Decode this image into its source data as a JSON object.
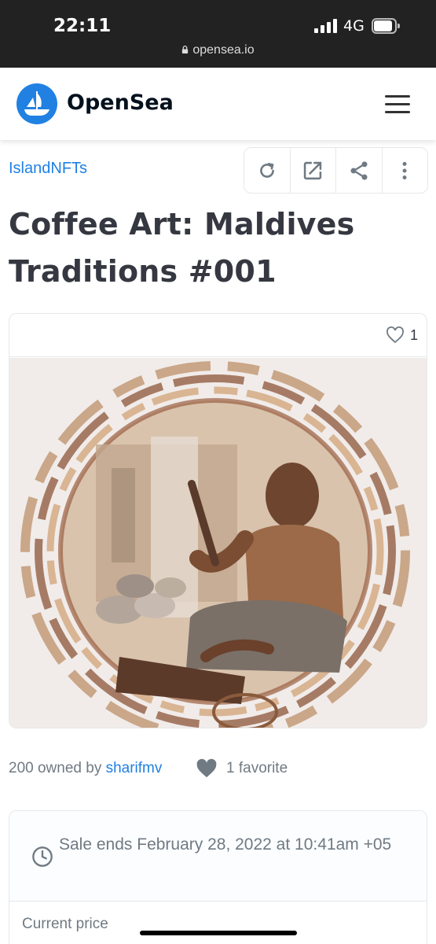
{
  "status_bar": {
    "time": "22:11",
    "network": "4G",
    "url": "opensea.io"
  },
  "header": {
    "brand": "OpenSea",
    "brand_color": "#2081e2"
  },
  "item": {
    "collection": "IslandNFTs",
    "title": "Coffee Art: Maldives Traditions #001",
    "favorite_count": "1",
    "owners_prefix": "200 owned by ",
    "owner": "sharifmv",
    "favorites": "1 favorite"
  },
  "toolbar": {
    "icons": [
      "refresh-icon",
      "external-link-icon",
      "share-icon",
      "more-icon"
    ]
  },
  "sale": {
    "ends_text": "Sale ends February 28, 2022 at 10:41am +05",
    "price_label": "Current price"
  }
}
